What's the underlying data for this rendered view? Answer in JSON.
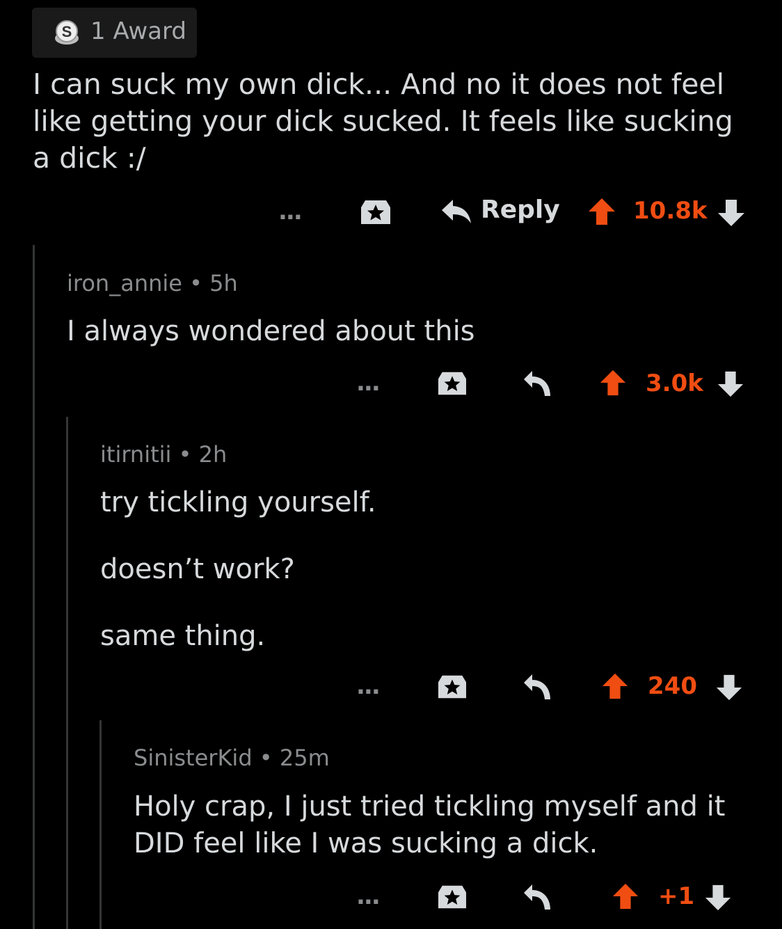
{
  "award": {
    "label": "1 Award"
  },
  "top_comment": {
    "body": "I can suck my own dick... And no it does not feel like getting your dick sucked. It feels like sucking a dick :/",
    "reply_label": "Reply",
    "score": "10.8k",
    "more": "..."
  },
  "comments": [
    {
      "user": "iron_annie",
      "sep": "•",
      "age": "5h",
      "body": [
        "I always wondered about this"
      ],
      "score": "3.0k",
      "more": "..."
    },
    {
      "user": "itirnitii",
      "sep": "•",
      "age": "2h",
      "body": [
        "try tickling yourself.",
        "doesn’t work?",
        "same thing."
      ],
      "score": "240",
      "more": "..."
    },
    {
      "user": "SinisterKid",
      "sep": "•",
      "age": "25m",
      "body": [
        "Holy crap, I just tried tickling myself and it DID feel like I was sucking a dick."
      ],
      "score": "+1",
      "more": "..."
    }
  ],
  "colors": {
    "upvote": "#f04d12",
    "text": "#d7dadc",
    "meta": "#8a8c8e",
    "line": "#343536"
  }
}
